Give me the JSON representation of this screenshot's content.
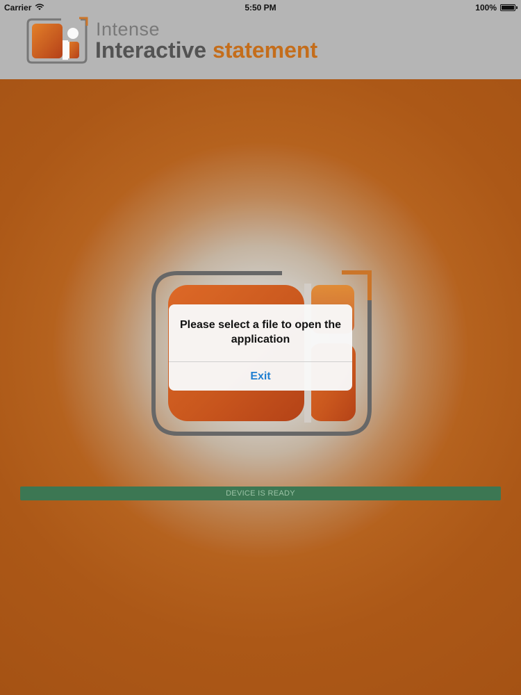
{
  "status_bar": {
    "carrier": "Carrier",
    "time": "5:50 PM",
    "battery": "100%",
    "battery_level": 1.0
  },
  "header": {
    "brand_small": "Intense",
    "brand_main": "Interactive",
    "brand_accent": "statement"
  },
  "main": {
    "ready_status": "DEVICE IS READY"
  },
  "alert": {
    "message": "Please select a file to open the application",
    "exit_label": "Exit"
  },
  "colors": {
    "accent_orange": "#c8701c",
    "ready_green": "#3e7a55",
    "link_blue": "#1f7fd1"
  }
}
